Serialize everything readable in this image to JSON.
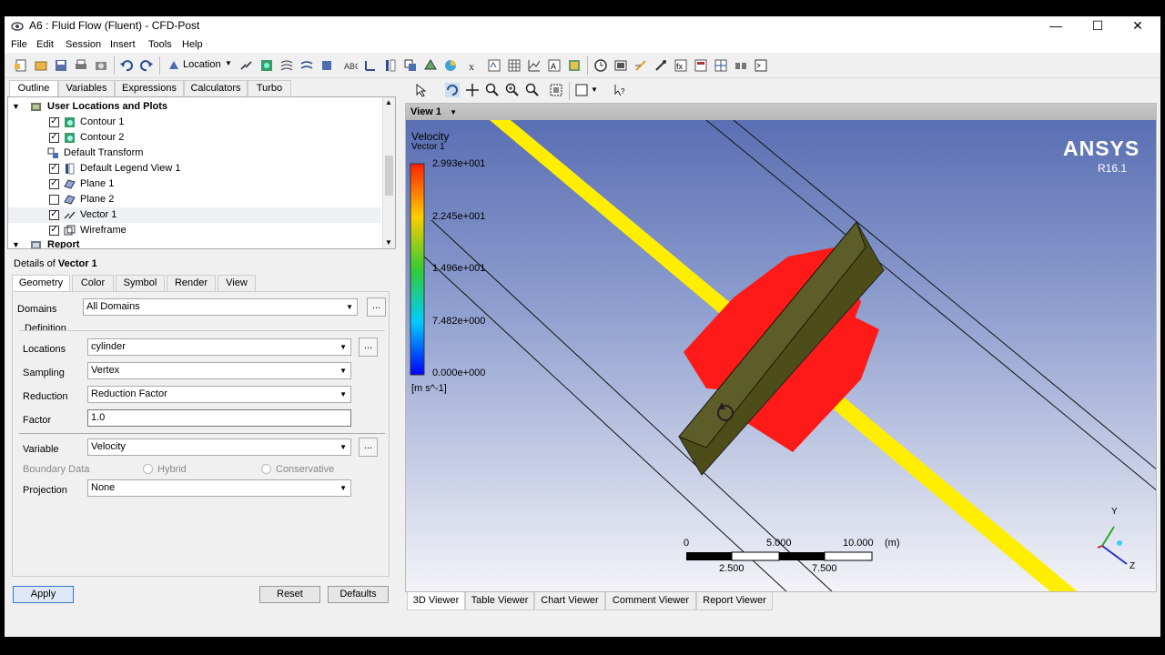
{
  "window": {
    "title": "A6 : Fluid Flow (Fluent) - CFD-Post",
    "controls": {
      "minimize": "—",
      "maximize": "☐",
      "close": "✕"
    }
  },
  "menu": [
    "File",
    "Edit",
    "Session",
    "Insert",
    "Tools",
    "Help"
  ],
  "toolbar": {
    "location_label": "Location"
  },
  "outline_tabs": [
    "Outline",
    "Variables",
    "Expressions",
    "Calculators",
    "Turbo"
  ],
  "tree": {
    "group1": "User Locations and Plots",
    "items": [
      {
        "label": "Contour 1",
        "checked": true
      },
      {
        "label": "Contour 2",
        "checked": true
      },
      {
        "label": "Default Transform",
        "checked": null
      },
      {
        "label": "Default Legend View 1",
        "checked": true
      },
      {
        "label": "Plane 1",
        "checked": true
      },
      {
        "label": "Plane 2",
        "checked": false
      },
      {
        "label": "Vector 1",
        "checked": true
      },
      {
        "label": "Wireframe",
        "checked": true
      }
    ],
    "group2": "Report"
  },
  "details": {
    "prefix": "Details of ",
    "object": "Vector 1",
    "tabs": [
      "Geometry",
      "Color",
      "Symbol",
      "Render",
      "View"
    ],
    "domains_label": "Domains",
    "domains_value": "All Domains",
    "definition_label": "Definition",
    "locations_label": "Locations",
    "locations_value": "cylinder",
    "sampling_label": "Sampling",
    "sampling_value": "Vertex",
    "reduction_label": "Reduction",
    "reduction_value": "Reduction Factor",
    "factor_label": "Factor",
    "factor_value": "1.0",
    "variable_label": "Variable",
    "variable_value": "Velocity",
    "boundary_label": "Boundary Data",
    "hybrid_label": "Hybrid",
    "conservative_label": "Conservative",
    "projection_label": "Projection",
    "projection_value": "None",
    "dots": "..."
  },
  "buttons": {
    "apply": "Apply",
    "reset": "Reset",
    "defaults": "Defaults"
  },
  "view": {
    "header": "View 1",
    "legend_title": "Velocity",
    "legend_subtitle": "Vector 1",
    "legend_ticks": [
      "2.993e+001",
      "2.245e+001",
      "1.496e+001",
      "7.482e+000",
      "0.000e+000"
    ],
    "legend_unit": "[m s^-1]",
    "logo": "ANSYS",
    "version": "R16.1",
    "scale_top": [
      "0",
      "5.000",
      "10.000",
      "(m)"
    ],
    "scale_bottom": [
      "2.500",
      "7.500"
    ],
    "axes": {
      "y": "Y",
      "z": "Z"
    }
  },
  "viewer_tabs": [
    "3D Viewer",
    "Table Viewer",
    "Chart Viewer",
    "Comment Viewer",
    "Report Viewer"
  ],
  "colors": {
    "accent": "#3377cc",
    "plane": "#ffff00",
    "vector": "#ff1a1a",
    "cylinder": "#4d4d1a"
  }
}
